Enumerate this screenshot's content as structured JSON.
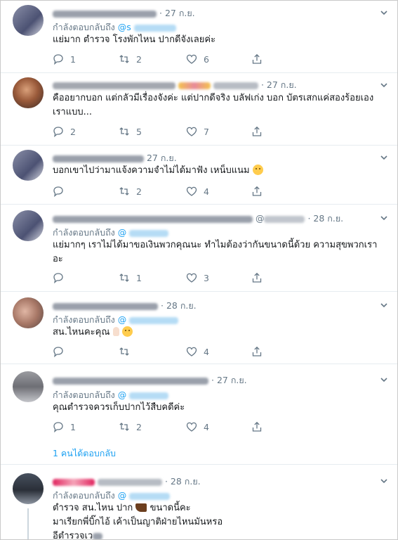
{
  "tweets": [
    {
      "date": "27 ก.ย.",
      "replying_label": "กำลังตอบกลับถึง",
      "replying_handle": "@s",
      "lines": [
        "แย่มาก ตำรวจ โรงพักไหน ปากดีจังเลยค่ะ"
      ],
      "stats": {
        "reply": "1",
        "retweet": "2",
        "like": "6"
      }
    },
    {
      "date": "27 ก.ย.",
      "lines": [
        "คืออยากบอก แต่กลัวมีเรื่องจังค่ะ แต่ปากดีจริง บลัฟเก่ง บอก บัตรเสกแค่สองร้อยเอง",
        "เราแบบ..."
      ],
      "stats": {
        "reply": "2",
        "retweet": "5",
        "like": "7"
      }
    },
    {
      "date": "27 ก.ย.",
      "lines": [
        "บอกเขาไปว่ามาแจ้งความจำไม่ได้มาฟัง เหน็บแนม"
      ],
      "stats": {
        "reply": "",
        "retweet": "2",
        "like": "4"
      }
    },
    {
      "date": "28 ก.ย.",
      "replying_label": "กำลังตอบกลับถึง",
      "replying_handle": "@",
      "lines": [
        "แย่มากๆ เราไม่ได้มาขอเงินพวกคุณนะ ทำไมต้องว่ากันขนาดนี้ด้วย ความสุขพวกเรา",
        "อะ"
      ],
      "stats": {
        "reply": "",
        "retweet": "1",
        "like": "3"
      }
    },
    {
      "date": "28 ก.ย.",
      "replying_label": "กำลังตอบกลับถึง",
      "replying_handle": "@",
      "lines": [
        "สน.ไหนคะคุณ"
      ],
      "stats": {
        "reply": "",
        "retweet": "",
        "like": "4"
      }
    },
    {
      "date": "27 ก.ย.",
      "replying_label": "กำลังตอบกลับถึง",
      "replying_handle": "@",
      "lines": [
        "คุณตำรวจควรเก็บปากไว้สืบคดีค่ะ"
      ],
      "stats": {
        "reply": "1",
        "retweet": "2",
        "like": "4"
      },
      "thread_link": "1 คนได้ตอบกลับ"
    },
    {
      "date": "28 ก.ย.",
      "replying_label": "กำลังตอบกลับถึง",
      "replying_handle": "@",
      "lines": [
        "ตำรวจ สน.ไหน ปาก",
        "ขนาดนี้คะ",
        "มาเรียกพี่บิ๊กไอ้ เค้าเป็นญาติฝ่ายไหนมันหรอ",
        "อีตำรวจเว"
      ]
    }
  ],
  "icons": {
    "reply": "reply-icon",
    "retweet": "retweet-icon",
    "like": "like-icon",
    "share": "share-icon",
    "more": "chevron-down-icon"
  }
}
